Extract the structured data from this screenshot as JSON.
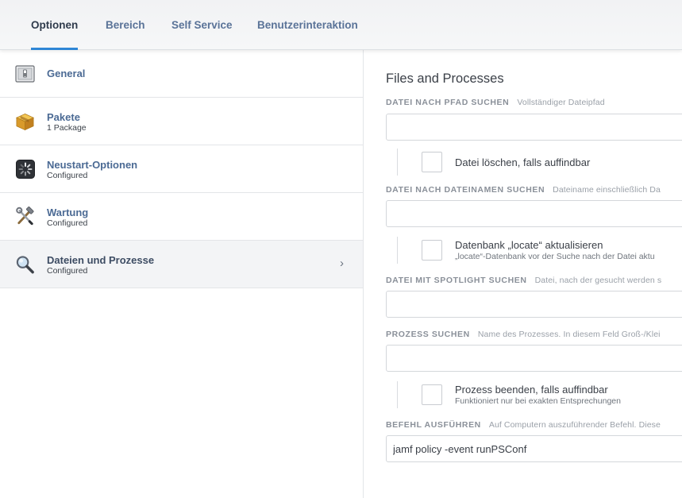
{
  "tabs": [
    {
      "label": "Optionen",
      "active": true
    },
    {
      "label": "Bereich",
      "active": false
    },
    {
      "label": "Self Service",
      "active": false
    },
    {
      "label": "Benutzerinteraktion",
      "active": false
    }
  ],
  "sidebar": {
    "items": [
      {
        "title": "General",
        "subtitle": "",
        "icon": "switch-icon"
      },
      {
        "title": "Pakete",
        "subtitle": "1 Package",
        "icon": "package-icon"
      },
      {
        "title": "Neustart-Optionen",
        "subtitle": "Configured",
        "icon": "restart-icon"
      },
      {
        "title": "Wartung",
        "subtitle": "Configured",
        "icon": "tools-icon"
      },
      {
        "title": "Dateien und Prozesse",
        "subtitle": "Configured",
        "icon": "magnifier-icon",
        "selected": true
      }
    ],
    "chevron": "›"
  },
  "main": {
    "title": "Files and Processes",
    "search_path": {
      "label": "DATEI NACH PFAD SUCHEN",
      "hint": "Vollständiger Dateipfad",
      "value": ""
    },
    "delete_file": {
      "label": "Datei löschen, falls auffindbar",
      "checked": false
    },
    "search_filename": {
      "label": "DATEI NACH DATEINAMEN SUCHEN",
      "hint": "Dateiname einschließlich Da",
      "value": ""
    },
    "update_locate": {
      "label": "Datenbank „locate“ aktualisieren",
      "sub": "„locate“-Datenbank vor der Suche nach der Datei aktu",
      "checked": false
    },
    "spotlight": {
      "label": "DATEI MIT SPOTLIGHT SUCHEN",
      "hint": "Datei, nach der gesucht werden s",
      "value": ""
    },
    "search_process": {
      "label": "PROZESS SUCHEN",
      "hint": "Name des Prozesses. In diesem Feld Groß-/Klei",
      "value": ""
    },
    "kill_process": {
      "label": "Prozess beenden, falls auffindbar",
      "sub": "Funktioniert nur bei exakten Entsprechungen",
      "checked": false
    },
    "command": {
      "label": "BEFEHL AUSFÜHREN",
      "hint": "Auf Computern auszuführender Befehl. Diese",
      "value": "jamf policy -event runPSConf"
    }
  }
}
